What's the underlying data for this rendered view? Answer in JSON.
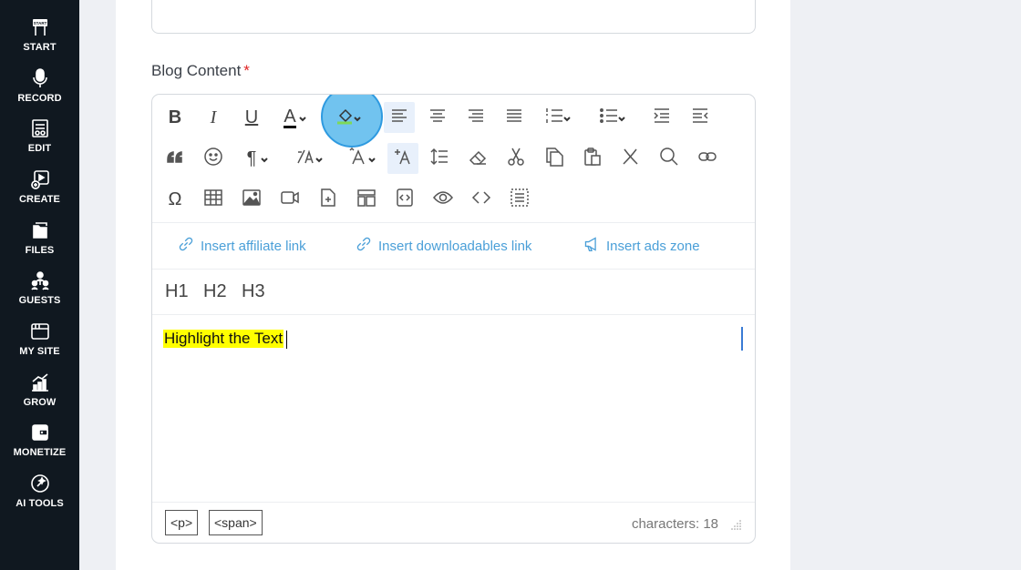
{
  "sidebar": {
    "items": [
      {
        "label": "START",
        "icon": "start-icon"
      },
      {
        "label": "RECORD",
        "icon": "microphone-icon"
      },
      {
        "label": "EDIT",
        "icon": "edit-icon"
      },
      {
        "label": "CREATE",
        "icon": "create-icon"
      },
      {
        "label": "FILES",
        "icon": "files-icon"
      },
      {
        "label": "GUESTS",
        "icon": "guests-icon"
      },
      {
        "label": "MY SITE",
        "icon": "my-site-icon"
      },
      {
        "label": "GROW",
        "icon": "grow-icon"
      },
      {
        "label": "MONETIZE",
        "icon": "monetize-icon"
      },
      {
        "label": "AI TOOLS",
        "icon": "ai-tools-icon"
      }
    ],
    "start_badge": "START"
  },
  "field": {
    "label": "Blog Content",
    "required_mark": "*"
  },
  "toolbar": {
    "bold": "B",
    "italic": "I",
    "underline": "U",
    "font_color_glyph": "A",
    "special_char_glyph": "Ω",
    "line_glyph": "¶"
  },
  "quick_links": {
    "affiliate": "Insert affiliate link",
    "downloadables": "Insert downloadables link",
    "ads_zone": "Insert ads zone"
  },
  "headings": {
    "h1": "H1",
    "h2": "H2",
    "h3": "H3"
  },
  "editor": {
    "content": "Highlight the Text"
  },
  "status": {
    "tag_p": "<p>",
    "tag_span": "<span>",
    "char_count": "characters: 18"
  },
  "colors": {
    "sidebar_bg": "#101820",
    "accent": "#4a9fd8",
    "highlight": "#ffff00",
    "focus_ring": "#58b9ec"
  }
}
